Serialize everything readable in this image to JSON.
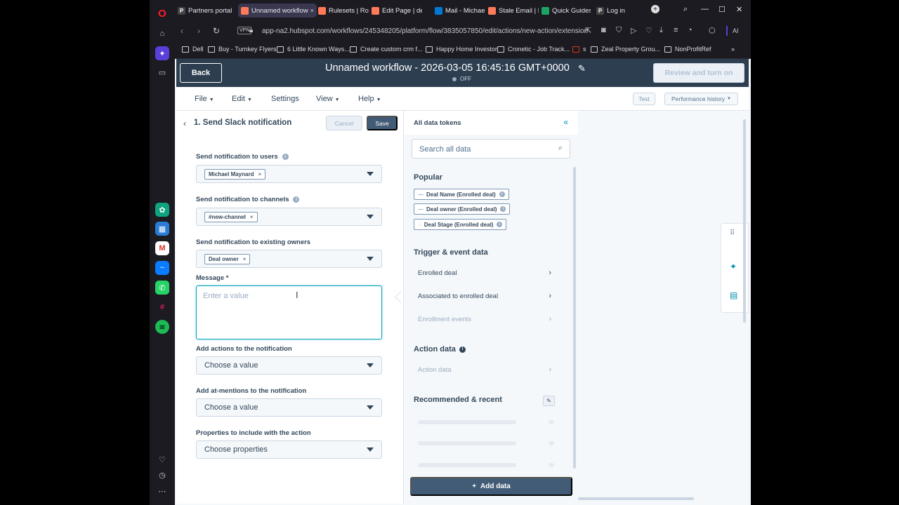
{
  "browser": {
    "tabs": [
      {
        "label": "Partners portal",
        "color": "#444"
      },
      {
        "label": "Unnamed workflow",
        "color": "#ff7a59"
      },
      {
        "label": "Rulesets | Rout",
        "color": "#ff7a59"
      },
      {
        "label": "Edit Page | der",
        "color": "#ff7a59"
      },
      {
        "label": "Mail - Michael",
        "color": "#0078d4"
      },
      {
        "label": "Stale Email | H",
        "color": "#ff7a59"
      },
      {
        "label": "Quick Guides",
        "color": "#1da462"
      },
      {
        "label": "Log in",
        "color": "#444"
      }
    ],
    "url": "app-na2.hubspot.com/workflows/245348205/platform/flow/3835057850/edit/actions/new-action/extension",
    "vpn_label": "VPN",
    "ai_label": "AI",
    "bookmarks": [
      "Dell",
      "Buy - Turnkey Flyers",
      "6 Little Known Ways...",
      "Create custom crm f...",
      "Happy Home Investor",
      "Cronetic - Job Track...",
      "s",
      "Zeal Property Grou...",
      "NonProfitRef"
    ]
  },
  "header": {
    "back_label": "Back",
    "title": "Unnamed workflow - 2026-03-05 16:45:16 GMT+0000",
    "status": "OFF",
    "review_label": "Review and turn on"
  },
  "menu": {
    "items": [
      "File",
      "Edit",
      "Settings",
      "View",
      "Help"
    ],
    "test_label": "Test",
    "performance_label": "Performance history"
  },
  "action_panel": {
    "title": "1. Send Slack notification",
    "cancel_label": "Cancel",
    "save_label": "Save",
    "fields": {
      "users": {
        "label": "Send notification to users",
        "chip": "Michael Maynard"
      },
      "channels": {
        "label": "Send notification to channels",
        "chip": "#new-channel"
      },
      "owners": {
        "label": "Send notification to existing owners",
        "chip": "Deal owner"
      },
      "message": {
        "label": "Message *",
        "placeholder": "Enter a value"
      },
      "actions": {
        "label": "Add actions to the notification",
        "placeholder": "Choose a value"
      },
      "mentions": {
        "label": "Add at-mentions to the notification",
        "placeholder": "Choose a value"
      },
      "properties": {
        "label": "Properties to include with the action",
        "placeholder": "Choose properties"
      }
    }
  },
  "tokens_panel": {
    "title": "All data tokens",
    "search_placeholder": "Search all data",
    "popular_heading": "Popular",
    "popular": [
      "Deal Name (Enrolled deal)",
      "Deal owner (Enrolled deal)",
      "Deal Stage (Enrolled deal)"
    ],
    "trigger_heading": "Trigger & event data",
    "trigger_items": [
      "Enrolled deal",
      "Associated to enrolled deal",
      "Enrollment events"
    ],
    "action_heading": "Action data",
    "action_items": [
      "Action data"
    ],
    "recommended_heading": "Recommended & recent",
    "add_label": "Add data"
  }
}
